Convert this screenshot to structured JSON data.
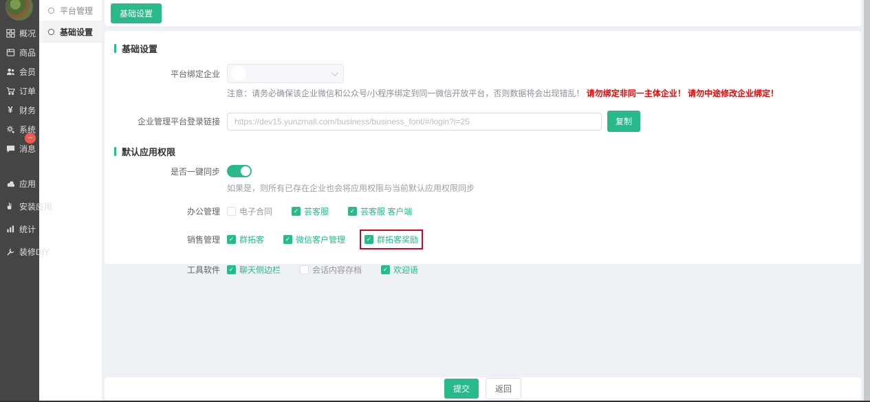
{
  "colors": {
    "green": "#29ba8b",
    "warning_red": "#f20000",
    "annotation_red": "#d9001b"
  },
  "sidebar": {
    "items_top": [
      {
        "label": "概况",
        "icon": "dashboard-icon"
      },
      {
        "label": "商品",
        "icon": "goods-icon"
      },
      {
        "label": "会员",
        "icon": "members-icon"
      },
      {
        "label": "订单",
        "icon": "orders-cart-icon"
      },
      {
        "label": "财务",
        "icon": "finance-yen-icon"
      },
      {
        "label": "系统",
        "icon": "system-gear-icon"
      },
      {
        "label": "消息",
        "icon": "message-bubble-icon"
      }
    ],
    "message_badge": "–",
    "items_bottom": [
      {
        "label": "应用",
        "icon": "apps-icon"
      },
      {
        "label": "安装应用",
        "icon": "install-app-icon"
      },
      {
        "label": "统计",
        "icon": "stats-chart-icon"
      },
      {
        "label": "装修DIY",
        "icon": "diy-wrench-icon"
      }
    ]
  },
  "submenu": {
    "items": [
      {
        "label": "平台管理",
        "active": false
      },
      {
        "label": "基础设置",
        "active": true
      }
    ]
  },
  "toolbar": {
    "tab_label": "基础设置"
  },
  "basic_section": {
    "title": "基础设置",
    "bind_company": {
      "label": "平台绑定企业"
    },
    "notice": {
      "gray": "注意：请务必确保该企业微信和公众号/小程序绑定到同一微信开放平台，否则数据将会出现错乱！",
      "red": "请勿绑定非同一主体企业！ 请勿中途修改企业绑定！"
    },
    "login_link": {
      "label": "企业管理平台登录链接",
      "value": "https://dev15.yunzmall.com/business/business_font/#/login?i=25",
      "copy_label": "复制"
    }
  },
  "perm_section": {
    "title": "默认应用权限",
    "sync": {
      "label": "是否一键同步",
      "enabled": true,
      "helper": "如果是，则所有已存在企业也会将应用权限与当前默认应用权限同步"
    },
    "groups": [
      {
        "label": "办公管理",
        "options": [
          {
            "label": "电子合同",
            "checked": false
          },
          {
            "label": "芸客服",
            "checked": true
          },
          {
            "label": "芸客服 客户端",
            "checked": true
          }
        ]
      },
      {
        "label": "销售管理",
        "options": [
          {
            "label": "群拓客",
            "checked": true
          },
          {
            "label": "微信客户管理",
            "checked": true
          },
          {
            "label": "群拓客奖励",
            "checked": true,
            "annotated": true
          }
        ]
      },
      {
        "label": "工具软件",
        "options": [
          {
            "label": "聊天侧边栏",
            "checked": true
          },
          {
            "label": "会话内容存档",
            "checked": false
          },
          {
            "label": "欢迎语",
            "checked": true
          }
        ]
      }
    ]
  },
  "footer": {
    "submit_label": "提交",
    "back_label": "返回"
  }
}
